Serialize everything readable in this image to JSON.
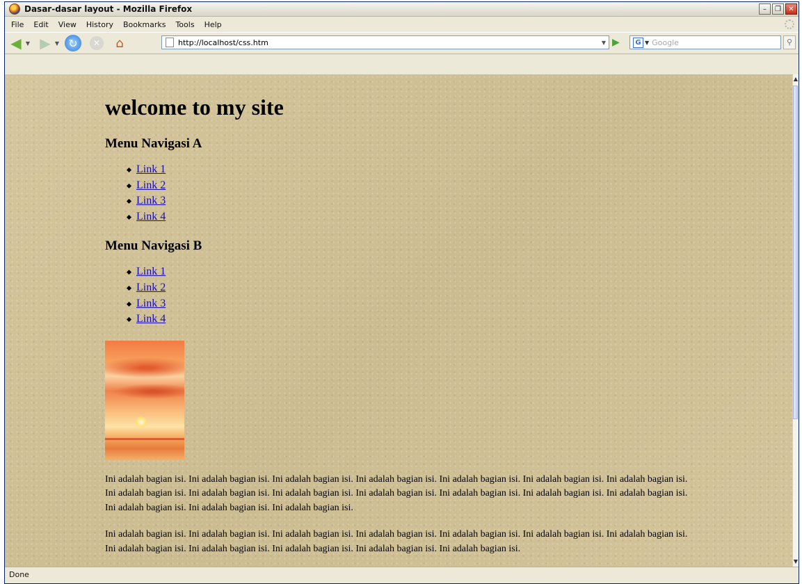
{
  "window": {
    "title": "Dasar-dasar layout - Mozilla Firefox",
    "minimize": "–",
    "restore": "❐",
    "close": "✕"
  },
  "menubar": {
    "items": [
      "File",
      "Edit",
      "View",
      "History",
      "Bookmarks",
      "Tools",
      "Help"
    ]
  },
  "navbar": {
    "back_icon": "back-arrow-icon",
    "forward_icon": "forward-arrow-icon",
    "url": "http://localhost/css.htm",
    "search_placeholder": "Google"
  },
  "page": {
    "title": "welcome to my site",
    "menu_a": {
      "heading": "Menu Navigasi A",
      "links": [
        "Link 1",
        "Link 2",
        "Link 3",
        "Link 4"
      ]
    },
    "menu_b": {
      "heading": "Menu Navigasi B",
      "links": [
        "Link 1",
        "Link 2",
        "Link 3",
        "Link 4"
      ]
    },
    "image": "sunset-photo",
    "paragraphs": [
      "Ini adalah bagian isi. Ini adalah bagian isi. Ini adalah bagian isi. Ini adalah bagian isi. Ini adalah bagian isi. Ini adalah bagian isi. Ini adalah bagian isi. Ini adalah bagian isi. Ini adalah bagian isi. Ini adalah bagian isi. Ini adalah bagian isi. Ini adalah bagian isi. Ini adalah bagian isi. Ini adalah bagian isi. Ini adalah bagian isi. Ini adalah bagian isi. Ini adalah bagian isi.",
      "Ini adalah bagian isi. Ini adalah bagian isi. Ini adalah bagian isi. Ini adalah bagian isi. Ini adalah bagian isi. Ini adalah bagian isi. Ini adalah bagian isi. Ini adalah bagian isi. Ini adalah bagian isi. Ini adalah bagian isi. Ini adalah bagian isi. Ini adalah bagian isi."
    ]
  },
  "status": {
    "text": "Done"
  },
  "colors": {
    "link": "#1a0dab",
    "page_background": "#cfbf94",
    "chrome": "#ece9d8"
  }
}
